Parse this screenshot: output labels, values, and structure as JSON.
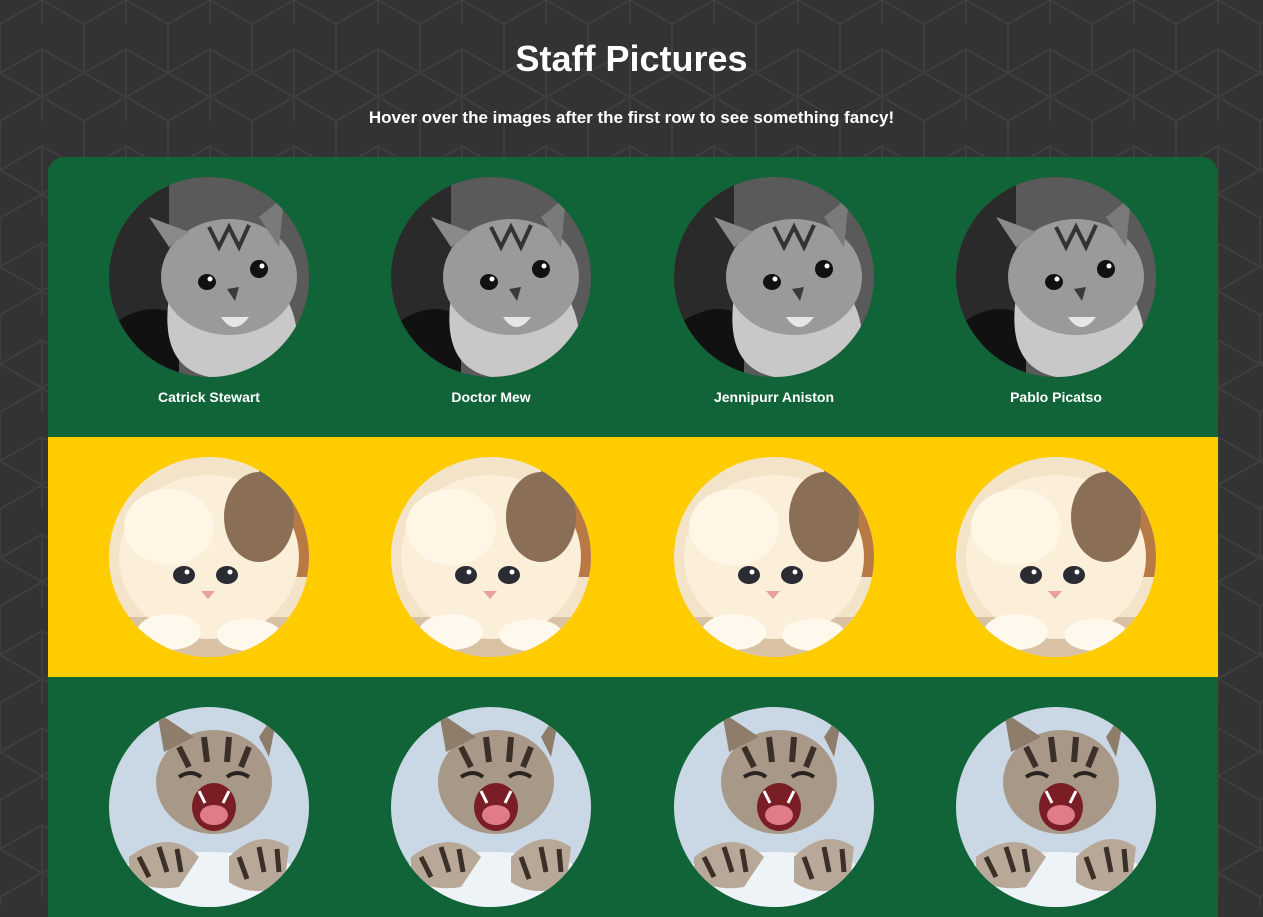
{
  "header": {
    "title": "Staff Pictures",
    "subtitle": "Hover over the images after the first row to see something fancy!"
  },
  "colors": {
    "page_background": "#333333",
    "pattern_line": "#3d3d3d",
    "row_green": "#116338",
    "row_yellow": "#ffcc00",
    "text": "#ffffff"
  },
  "gallery": {
    "rows": [
      {
        "background": "#116338",
        "photo_style": "grayscale tabby kitten",
        "staff": [
          {
            "name": "Catrick Stewart"
          },
          {
            "name": "Doctor Mew"
          },
          {
            "name": "Jennipurr Aniston"
          },
          {
            "name": "Pablo Picatso"
          }
        ]
      },
      {
        "background": "#ffcc00",
        "photo_style": "fluffy cream kitten",
        "staff": [
          {},
          {},
          {},
          {}
        ]
      },
      {
        "background": "#116338",
        "photo_style": "yawning tabby kitten",
        "staff": [
          {},
          {},
          {},
          {}
        ]
      }
    ]
  }
}
